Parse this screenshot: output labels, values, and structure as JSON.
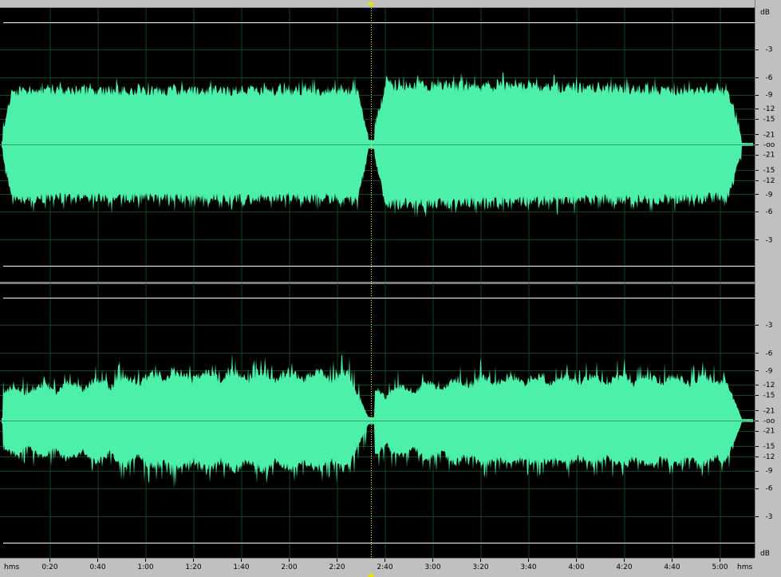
{
  "colors": {
    "waveform": "#4cf0a8",
    "background": "#000000",
    "grid": "#12451f",
    "ruler": "#c0c0c0",
    "cursor": "#ffff40",
    "boundary": "#ffffff"
  },
  "timeline": {
    "unit_left": "hms",
    "unit_right": "hms",
    "ticks": [
      "0:20",
      "0:40",
      "1:00",
      "1:20",
      "1:40",
      "2:00",
      "2:20",
      "2:40",
      "3:00",
      "3:20",
      "3:40",
      "4:00",
      "4:20",
      "4:40",
      "5:00"
    ]
  },
  "db_scale": {
    "top_label": "dB",
    "bottom_label": "dB",
    "channel_labels": [
      "-3",
      "-6",
      "-9",
      "-12",
      "-15",
      "-21",
      "-oo",
      "-21",
      "-15",
      "-12",
      "-9",
      "-6",
      "-3"
    ]
  },
  "playhead": {
    "time": "2:35"
  }
}
